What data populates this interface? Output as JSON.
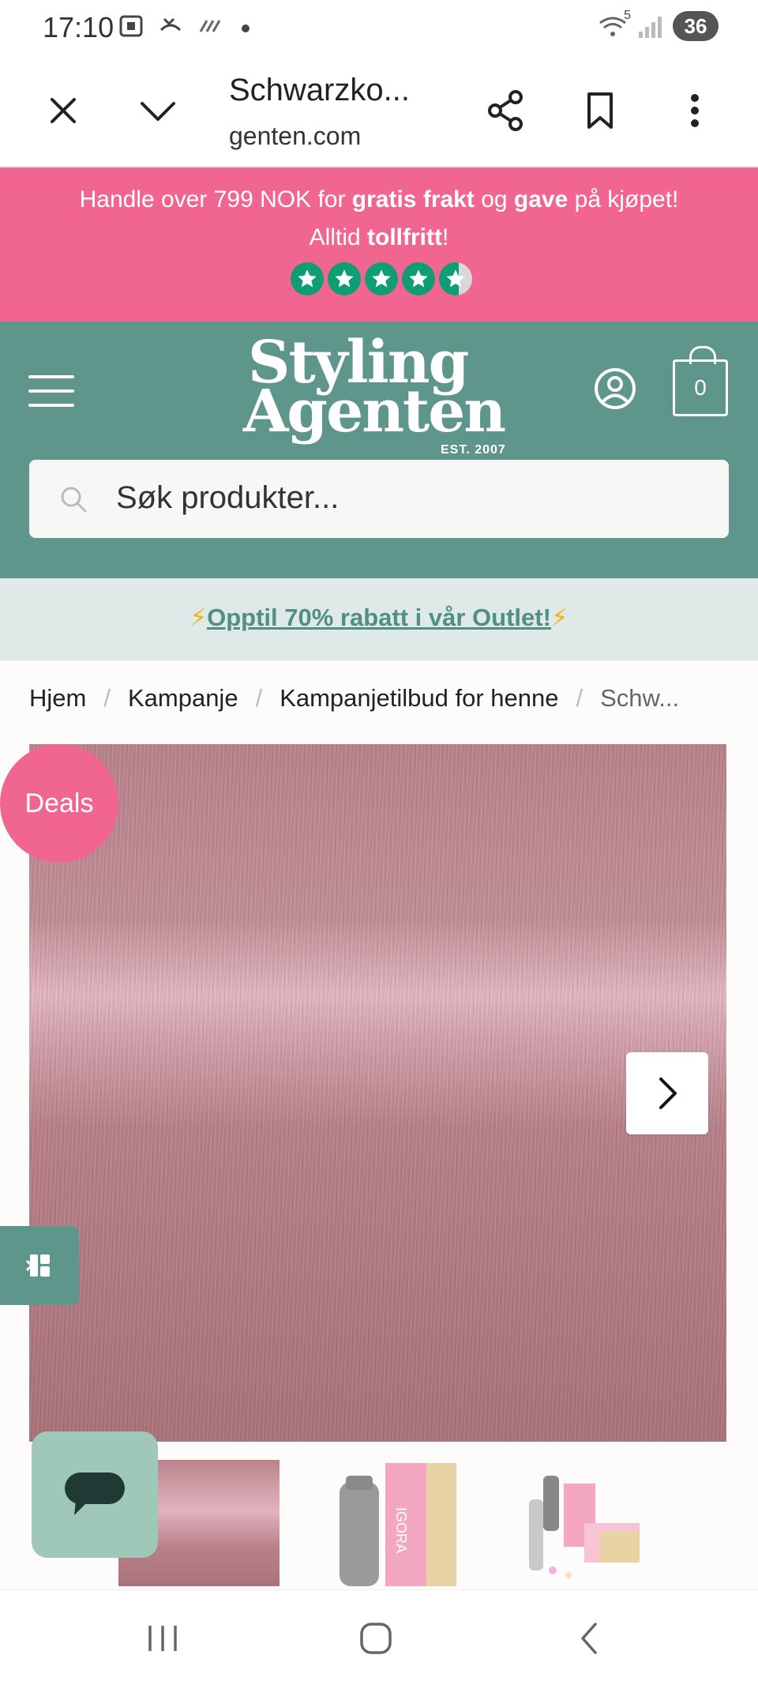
{
  "status_bar": {
    "time": "17:10",
    "network_label": "5",
    "battery": "36"
  },
  "browser": {
    "title": "Schwarzko...",
    "url": "genten.com"
  },
  "promo": {
    "line1_a": "Handle over 799 NOK for ",
    "line1_b": "gratis frakt",
    "line1_c": " og ",
    "line1_d": "gave",
    "line1_e": " på kjøpet!",
    "line2_a": "Alltid ",
    "line2_b": "tollfritt",
    "line2_c": "!",
    "rating_stars": 4.5,
    "star_color": "#0f9e74"
  },
  "header": {
    "logo_line1": "Styling",
    "logo_line2": "Agenten",
    "logo_est": "EST. 2007",
    "cart_count": "0",
    "search_placeholder": "Søk produkter...",
    "brand_color": "#5f968b"
  },
  "outlet": {
    "bolt_left": "⚡",
    "link_text": "Opptil 70% rabatt i vår Outlet!",
    "bolt_right": "⚡"
  },
  "breadcrumb": {
    "items": [
      "Hjem",
      "Kampanje",
      "Kampanjetilbud for henne"
    ],
    "separator": "/",
    "current": "Schw..."
  },
  "product": {
    "badge": "Deals",
    "badge_color": "#f06690"
  }
}
